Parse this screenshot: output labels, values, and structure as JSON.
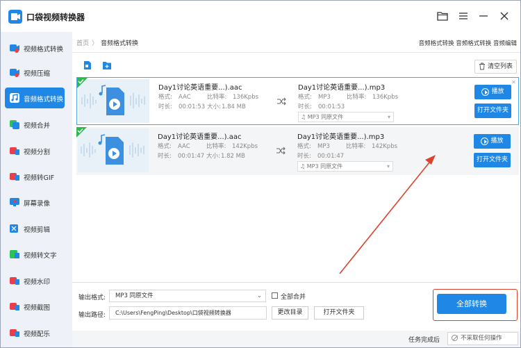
{
  "app": {
    "title": "口袋视频转换器"
  },
  "titlebar_icons": [
    "folder-icon",
    "menu-icon",
    "minimize-icon",
    "close-icon"
  ],
  "sidebar": {
    "items": [
      {
        "label": "视频格式转换",
        "icon": "video-convert-icon",
        "color": "#1f87e5"
      },
      {
        "label": "视频压缩",
        "icon": "compress-icon",
        "color": "#1f87e5"
      },
      {
        "label": "音频格式转换",
        "icon": "audio-convert-icon",
        "color": "#1f87e5",
        "active": true
      },
      {
        "label": "视频合并",
        "icon": "merge-icon",
        "color": "#2ec05a"
      },
      {
        "label": "视频分割",
        "icon": "split-icon",
        "color": "#e8404a"
      },
      {
        "label": "视频转GIF",
        "icon": "gif-icon",
        "color": "#e8404a"
      },
      {
        "label": "屏幕录像",
        "icon": "screen-record-icon",
        "color": "#1f87e5"
      },
      {
        "label": "视频剪辑",
        "icon": "cut-icon",
        "color": "#1f87e5"
      },
      {
        "label": "视频转文字",
        "icon": "video-to-text-icon",
        "color": "#2ec05a"
      },
      {
        "label": "视频水印",
        "icon": "watermark-icon",
        "color": "#e8404a"
      },
      {
        "label": "视频截图",
        "icon": "screenshot-icon",
        "color": "#e8404a"
      },
      {
        "label": "视频配乐",
        "icon": "music-icon",
        "color": "#e8404a"
      }
    ]
  },
  "breadcrumb": {
    "home": "首页",
    "sep": "〉",
    "current": "音频格式转换"
  },
  "top_right_links": "音频格式转换  音频格式转换 音频编辑",
  "toolbar": {
    "clear_label": "清空列表"
  },
  "labels": {
    "format": "格式:",
    "bitrate": "比特率:",
    "duration": "时长:",
    "size": "大小:",
    "play": "播放",
    "open_folder": "打开文件夹"
  },
  "files": [
    {
      "source_name": "Day1讨论英语重要...).aac",
      "source_format": "AAC",
      "source_bitrate": "136Kpbs",
      "source_duration": "00:01:53",
      "source_size": "1.84 MB",
      "target_name": "Day1讨论英语重要...).mp3",
      "target_format": "MP3",
      "target_bitrate": "136Kpbs",
      "target_duration": "00:01:53",
      "target_select": "MP3   同原文件"
    },
    {
      "source_name": "Day1讨论英语重要...).aac",
      "source_format": "AAC",
      "source_bitrate": "142Kpbs",
      "source_duration": "00:01:47",
      "source_size": "1.82 MB",
      "target_name": "Day1讨论英语重要...).mp3",
      "target_format": "MP3",
      "target_bitrate": "142Kpbs",
      "target_duration": "00:01:47",
      "target_select": "MP3   同原文件"
    }
  ],
  "bottom": {
    "output_format_label": "输出格式:",
    "output_format_value": "MP3   同原文件",
    "merge_label": "全部合并",
    "output_path_label": "输出路径:",
    "output_path_value": "C:\\Users\\FengPing\\Desktop\\口袋视频转换器",
    "change_dir_label": "更改目录",
    "open_folder_label": "打开文件夹",
    "convert_all_label": "全部转换"
  },
  "footer": {
    "after_done_label": "任务完成后",
    "after_done_value": "不采取任何操作"
  },
  "colors": {
    "accent": "#1f87e5",
    "highlight": "#d9442f",
    "check": "#2eb84f"
  }
}
